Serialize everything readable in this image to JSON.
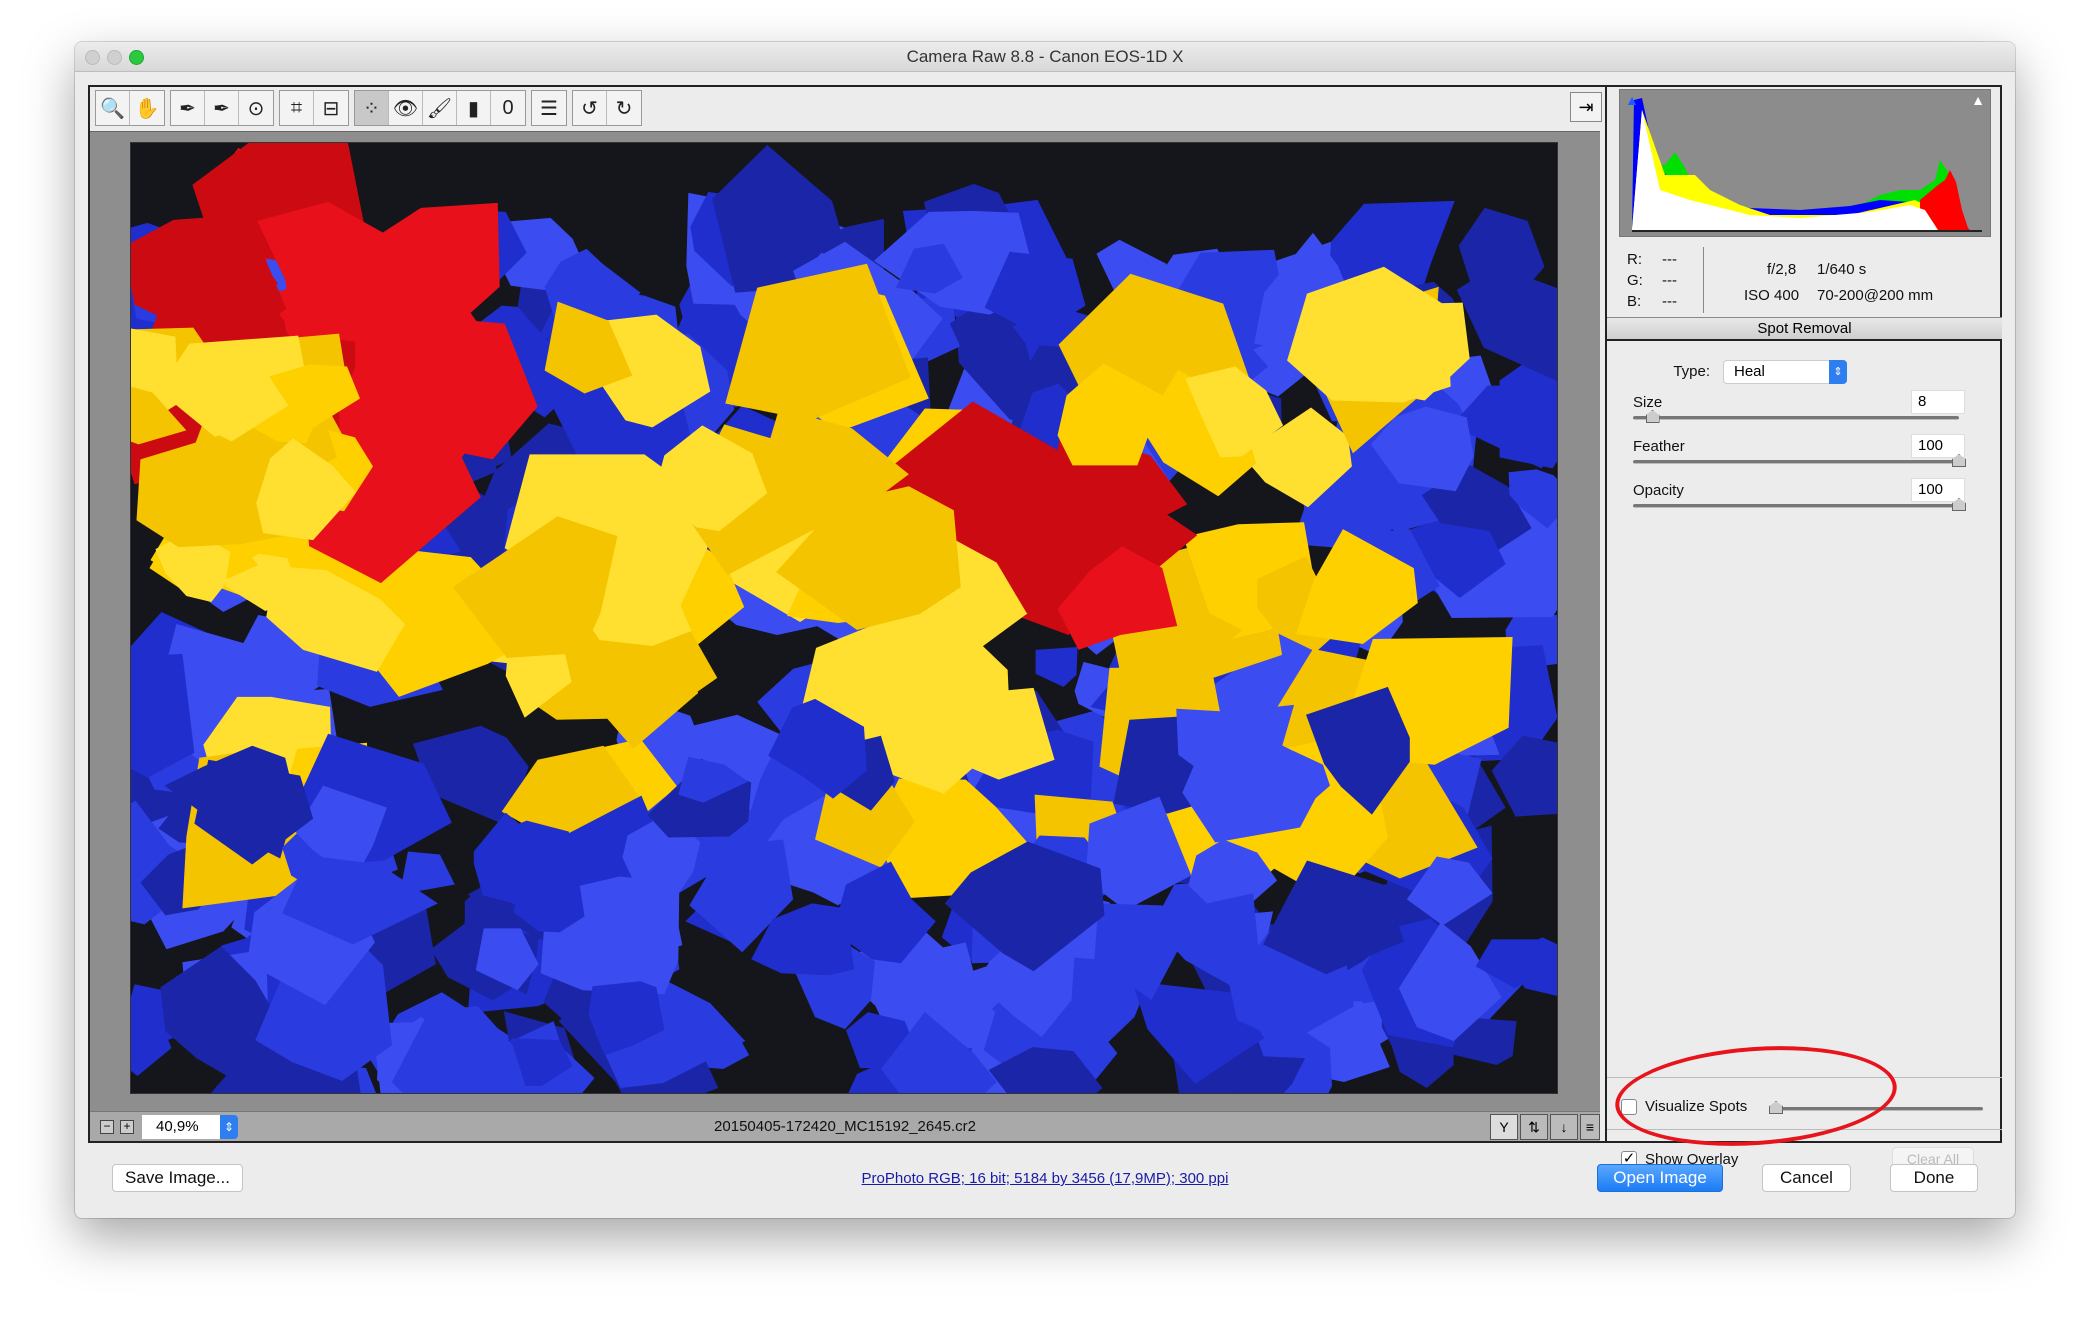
{
  "window": {
    "title": "Camera Raw 8.8  -  Canon EOS-1D X"
  },
  "toolbar": {
    "groups": [
      [
        {
          "icon": "zoom-icon",
          "g": "🔍"
        },
        {
          "icon": "hand-icon",
          "g": "✋"
        }
      ],
      [
        {
          "icon": "white-balance-icon",
          "g": "✒"
        },
        {
          "icon": "color-sampler-icon",
          "g": "✒"
        },
        {
          "icon": "targeted-adjustment-icon",
          "g": "⊙"
        }
      ],
      [
        {
          "icon": "crop-icon",
          "g": "⌗"
        },
        {
          "icon": "straighten-icon",
          "g": "⊟"
        }
      ],
      [
        {
          "icon": "spot-removal-icon",
          "g": "⁘",
          "active": true
        },
        {
          "icon": "red-eye-icon",
          "g": "👁"
        },
        {
          "icon": "adjustment-brush-icon",
          "g": "🖌"
        },
        {
          "icon": "graduated-filter-icon",
          "g": "▮"
        },
        {
          "icon": "radial-filter-icon",
          "g": "0"
        }
      ],
      [
        {
          "icon": "preferences-icon",
          "g": "☰"
        }
      ],
      [
        {
          "icon": "rotate-ccw-icon",
          "g": "↺"
        },
        {
          "icon": "rotate-cw-icon",
          "g": "↻"
        }
      ]
    ]
  },
  "image": {
    "filename": "20150405-172420_MC15192_2645.cr2",
    "zoom": "40,9%"
  },
  "info": {
    "r_label": "R:",
    "g_label": "G:",
    "b_label": "B:",
    "r": "---",
    "g": "---",
    "b": "---",
    "aperture": "f/2,8",
    "shutter": "1/640 s",
    "iso": "ISO 400",
    "lens": "70-200@200 mm"
  },
  "panel": {
    "title": "Spot Removal",
    "type_label": "Type:",
    "type_value": "Heal",
    "sliders": [
      {
        "label": "Size",
        "value": "8",
        "fraction": 0.06
      },
      {
        "label": "Feather",
        "value": "100",
        "fraction": 1
      },
      {
        "label": "Opacity",
        "value": "100",
        "fraction": 1
      }
    ],
    "visualize_spots": "Visualize Spots",
    "visualize_checked": false,
    "show_overlay": "Show Overlay",
    "show_overlay_checked": true,
    "clear_all": "Clear All"
  },
  "footer": {
    "save": "Save Image...",
    "workflow": "ProPhoto RGB; 16 bit; 5184 by 3456 (17,9MP); 300 ppi",
    "open": "Open Image",
    "cancel": "Cancel",
    "done": "Done"
  },
  "colors": {
    "accent": "#1b7cf5",
    "annotation": "#e8141c"
  }
}
